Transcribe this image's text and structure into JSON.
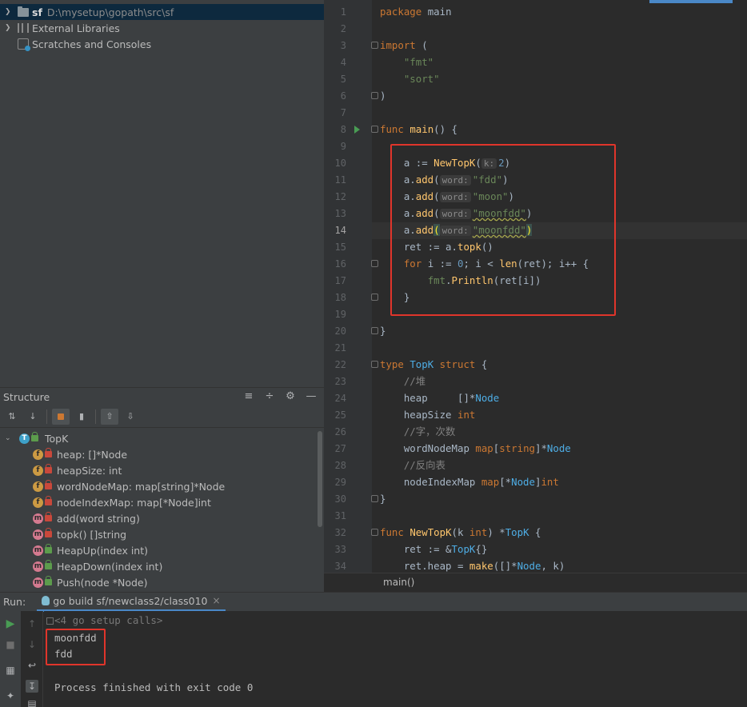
{
  "project": {
    "root_name": "sf",
    "root_path": "D:\\mysetup\\gopath\\src\\sf",
    "external_libraries": "External Libraries",
    "scratches": "Scratches and Consoles"
  },
  "structure": {
    "title": "Structure",
    "root": "TopK",
    "items": [
      {
        "kind": "f",
        "text": "heap: []*Node"
      },
      {
        "kind": "f",
        "text": "heapSize: int"
      },
      {
        "kind": "f",
        "text": "wordNodeMap: map[string]*Node"
      },
      {
        "kind": "f",
        "text": "nodeIndexMap: map[*Node]int"
      },
      {
        "kind": "m",
        "text": "add(word string)"
      },
      {
        "kind": "m",
        "text": "topk() []string"
      },
      {
        "kind": "m",
        "text": "HeapUp(index int)"
      },
      {
        "kind": "m",
        "text": "HeapDown(index int)"
      },
      {
        "kind": "m",
        "text": "Push(node *Node)"
      }
    ]
  },
  "editor": {
    "line_numbers": [
      "1",
      "2",
      "3",
      "4",
      "5",
      "6",
      "7",
      "8",
      "9",
      "10",
      "11",
      "12",
      "13",
      "14",
      "15",
      "16",
      "17",
      "18",
      "19",
      "20",
      "21",
      "22",
      "23",
      "24",
      "25",
      "26",
      "27",
      "28",
      "29",
      "30",
      "31",
      "32",
      "33",
      "34"
    ],
    "current_line": 14,
    "hints": {
      "k": "k:",
      "word": "word:"
    },
    "code": {
      "l1": [
        "package",
        "main"
      ],
      "l3": [
        "import",
        "("
      ],
      "l4": "\"fmt\"",
      "l5": "\"sort\"",
      "l6": ")",
      "l8": [
        "func",
        "main",
        "() {"
      ],
      "l10": [
        "a := ",
        "NewTopK",
        "(",
        "2",
        ")"
      ],
      "l11": [
        "a.",
        "add",
        "(",
        "\"fdd\"",
        ")"
      ],
      "l12": [
        "a.",
        "add",
        "(",
        "\"moon\"",
        ")"
      ],
      "l13": [
        "a.",
        "add",
        "(",
        "\"moonfdd\"",
        ")"
      ],
      "l14": [
        "a.",
        "add",
        "(",
        "\"moonfdd\"",
        ")"
      ],
      "l15": [
        "ret := a.",
        "topk",
        "()"
      ],
      "l16": [
        "for",
        " i := ",
        "0",
        "; i < ",
        "len",
        "(ret); i++ {"
      ],
      "l17": [
        "fmt",
        ".",
        "Println",
        "(ret[i])"
      ],
      "l18": "}",
      "l20": "}",
      "l22": [
        "type",
        "TopK",
        "struct",
        "{"
      ],
      "l23": "//堆",
      "l24": [
        "heap     ",
        "[]*",
        "Node"
      ],
      "l25": [
        "heapSize ",
        "int"
      ],
      "l26": "//字，次数",
      "l27": [
        "wordNodeMap ",
        "map",
        "[",
        "string",
        "]*",
        "Node"
      ],
      "l28": "//反向表",
      "l29": [
        "nodeIndexMap ",
        "map",
        "[*",
        "Node",
        "]",
        "int"
      ],
      "l30": "}",
      "l32": [
        "func",
        "NewTopK",
        "(k ",
        "int",
        ") *",
        "TopK",
        " {"
      ],
      "l33": [
        "ret := &",
        "TopK",
        "{}"
      ],
      "l34": [
        "ret.heap = ",
        "make",
        "([]*",
        "Node",
        ", k)"
      ]
    },
    "breadcrumb": "main()"
  },
  "run": {
    "label": "Run:",
    "tab": "go build sf/newclass2/class010",
    "close": "×",
    "setup_calls": "<4 go setup calls>",
    "output": [
      "moonfdd",
      "fdd"
    ],
    "finished": "Process finished with exit code 0"
  },
  "colors": {
    "highlight_box": "#e0352b",
    "keyword": "#cc7832",
    "function": "#ffc66d",
    "string": "#6a8759",
    "number": "#6897bb",
    "type": "#4eade5"
  }
}
